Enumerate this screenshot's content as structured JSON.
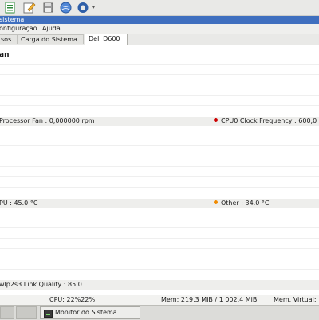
{
  "window": {
    "title": "sistema"
  },
  "toolbar": {
    "buttons": [
      {
        "icon": "spreadsheet-icon"
      },
      {
        "icon": "edit-icon"
      },
      {
        "icon": "save-icon"
      },
      {
        "icon": "globe-icon"
      },
      {
        "icon": "refresh-dropdown-icon"
      }
    ]
  },
  "menu": {
    "items": [
      "onfiguração",
      "Ajuda"
    ]
  },
  "tabs": {
    "items": [
      "sos",
      "Carga do Sistema",
      "Dell D600"
    ],
    "active": "Dell D600"
  },
  "section": {
    "title": "an"
  },
  "readouts": {
    "row1_left": "Processor Fan : 0,000000 rpm",
    "row1_right": "CPU0 Clock Frequency : 600,0",
    "row2_left": "PU : 45.0 °C",
    "row2_right": "Other : 34.0 °C",
    "row3_left": "wlp2s3 Link Quality : 85.0",
    "colors": {
      "cpu0": "#cc0000",
      "other": "#f08a00"
    }
  },
  "status": {
    "cpu": "CPU: 22%22%",
    "mem": "Mem: 219,3 MiB / 1 002,4 MiB",
    "virtual": "Mem. Virtual:"
  },
  "taskbar": {
    "app_label": "Monitor do Sistema"
  }
}
